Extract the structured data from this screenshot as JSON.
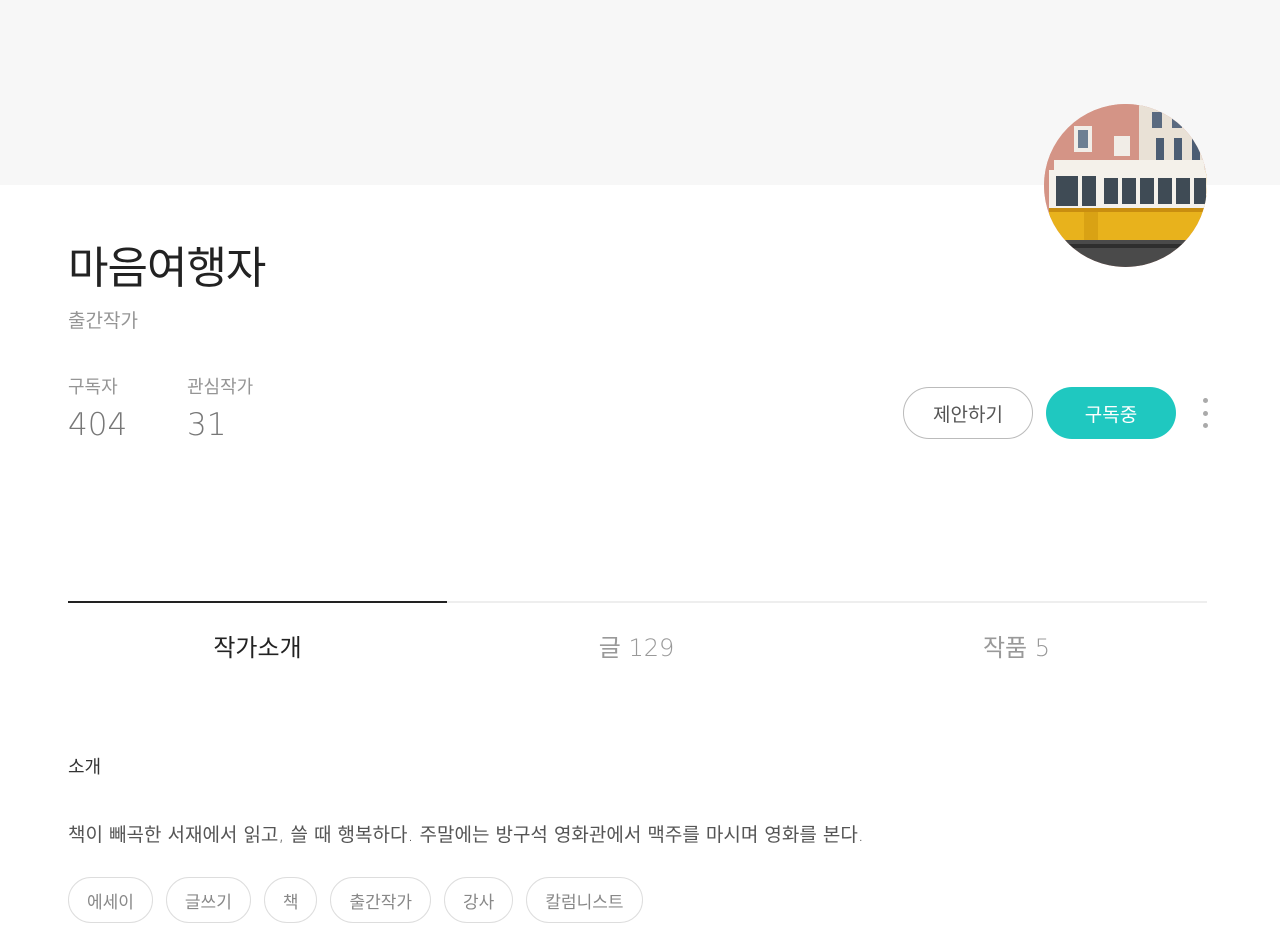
{
  "profile": {
    "name": "마음여행자",
    "role": "출간작가",
    "stats": [
      {
        "label": "구독자",
        "value": "404"
      },
      {
        "label": "관심작가",
        "value": "31"
      }
    ]
  },
  "actions": {
    "propose_label": "제안하기",
    "subscribed_label": "구독중"
  },
  "tabs": [
    {
      "label": "작가소개",
      "active": true
    },
    {
      "label": "글 129",
      "active": false
    },
    {
      "label": "작품 5",
      "active": false
    }
  ],
  "intro": {
    "heading": "소개",
    "text": "책이 빼곡한 서재에서 읽고, 쓸 때 행복하다. 주말에는 방구석 영화관에서 맥주를 마시며 영화를 본다."
  },
  "keywords": [
    "에세이",
    "글쓰기",
    "책",
    "출간작가",
    "강사",
    "칼럼니스트"
  ],
  "colors": {
    "accent": "#1fc8c0",
    "cover_bg": "#f7f7f7"
  },
  "icons": {
    "more": "more-vertical-icon"
  }
}
